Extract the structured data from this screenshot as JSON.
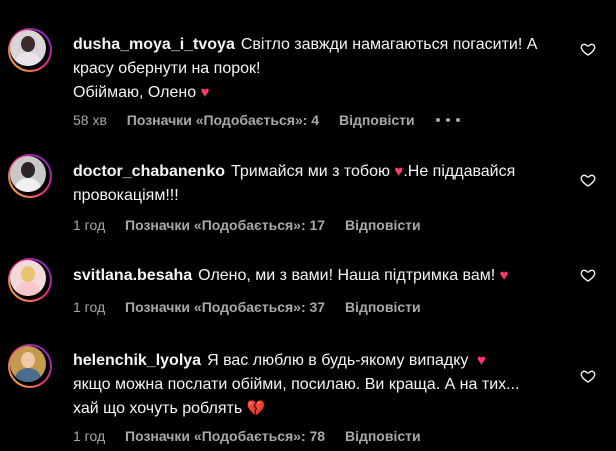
{
  "comments": [
    {
      "username": "dusha_moya_i_tvoya",
      "text_line1": "Світло завжди намагаються погасити! А",
      "text_line2": "красу обернути на порок!",
      "text_line3": "Обіймаю, Олено",
      "emoji": "heart-icon",
      "time": "58 хв",
      "likes": "Позначки «Подобається»: 4",
      "reply": "Відповісти",
      "more": "more-options-icon"
    },
    {
      "username": "doctor_chabanenko",
      "text_line1": "Тримайся ми з тобою",
      "text_line1_after": ".Не піддавайся",
      "text_line2": "провокаціям!!!",
      "emoji": "heart-icon",
      "time": "1 год",
      "likes": "Позначки «Подобається»: 17",
      "reply": "Відповісти"
    },
    {
      "username": "svitlana.besaha",
      "text_line1": "Олено, ми з вами! Наша підтримка вам!",
      "emoji": "heart-icon",
      "time": "1 год",
      "likes": "Позначки «Подобається»: 37",
      "reply": "Відповісти"
    },
    {
      "username": "helenchik_lyolya",
      "text_line1": "Я вас люблю в будь-якому випадку",
      "text_line2": "якщо можна послати обійми, посилаю. Ви краща. А на тих...",
      "text_line3": "хай що хочуть роблять",
      "emoji": "heart-icon",
      "emoji2": "broken-heart-icon",
      "time": "1 год",
      "likes": "Позначки «Подобається»: 78",
      "reply": "Відповісти"
    }
  ],
  "colors": {
    "background": "#000000",
    "text": "#f5f5f5",
    "secondary": "#a8a8a8",
    "heart": "#ff3b6b"
  }
}
